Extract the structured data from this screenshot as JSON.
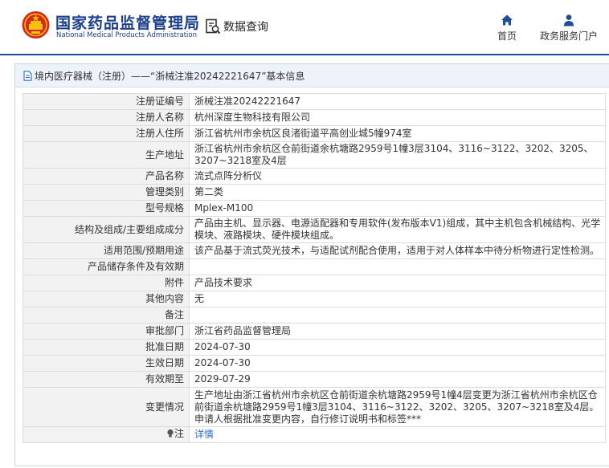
{
  "header": {
    "org_name_cn": "国家药品监督管理局",
    "org_name_en": "National Medical Products Administration",
    "data_query_label": "数据查询",
    "nav": [
      {
        "label": "首页",
        "icon": "home-icon"
      },
      {
        "label": "政务服务门户",
        "icon": "user-icon"
      }
    ]
  },
  "colors": {
    "brand_blue": "#1b3f8b",
    "rule_blue": "#1f4e96",
    "link_blue": "#2d6fc4",
    "emblem_red": "#d62a1e",
    "emblem_gold": "#f4c20d"
  },
  "panel": {
    "title": "境内医疗器械（注册）——“浙械注准20242221647”基本信息"
  },
  "record": {
    "rows": [
      {
        "label": "注册证编号",
        "value": "浙械注准20242221647"
      },
      {
        "label": "注册人名称",
        "value": "杭州深度生物科技有限公司"
      },
      {
        "label": "注册人住所",
        "value": "浙江省杭州市余杭区良渚街道平高创业城5幢974室"
      },
      {
        "label": "生产地址",
        "value": "浙江省杭州市余杭区仓前街道余杭塘路2959号1幢3层3104、3116~3122、3202、3205、3207~3218室及4层"
      },
      {
        "label": "产品名称",
        "value": "流式点阵分析仪"
      },
      {
        "label": "管理类别",
        "value": "第二类"
      },
      {
        "label": "型号规格",
        "value": "Mplex-M100"
      },
      {
        "label": "结构及组成/主要组成成分",
        "value": "产品由主机、显示器、电源适配器和专用软件(发布版本V1)组成，其中主机包含机械结构、光学模块、液路模块、硬件模块组成。"
      },
      {
        "label": "适用范围/预期用途",
        "value": "该产品基于流式荧光技术，与适配试剂配合使用，适用于对人体样本中待分析物进行定性检测。"
      },
      {
        "label": "产品储存条件及有效期",
        "value": ""
      },
      {
        "label": "附件",
        "value": "产品技术要求"
      },
      {
        "label": "其他内容",
        "value": "无"
      },
      {
        "label": "备注",
        "value": ""
      },
      {
        "label": "审批部门",
        "value": "浙江省药品监督管理局"
      },
      {
        "label": "批准日期",
        "value": "2024-07-30"
      },
      {
        "label": "生效日期",
        "value": "2024-07-30"
      },
      {
        "label": "有效期至",
        "value": "2029-07-29"
      },
      {
        "label": "变更情况",
        "value": "生产地址由浙江省杭州市余杭区仓前街道余杭塘路2959号1幢4层变更为浙江省杭州市余杭区仓前街道余杭塘路2959号1幢3层3104、3116~3122、3202、3205、3207~3218室及4层。申请人根据批准变更内容，自行修订说明书和标签***"
      }
    ],
    "note_label": "注",
    "note_link": "详情",
    "note_icon": "bulb-icon"
  }
}
